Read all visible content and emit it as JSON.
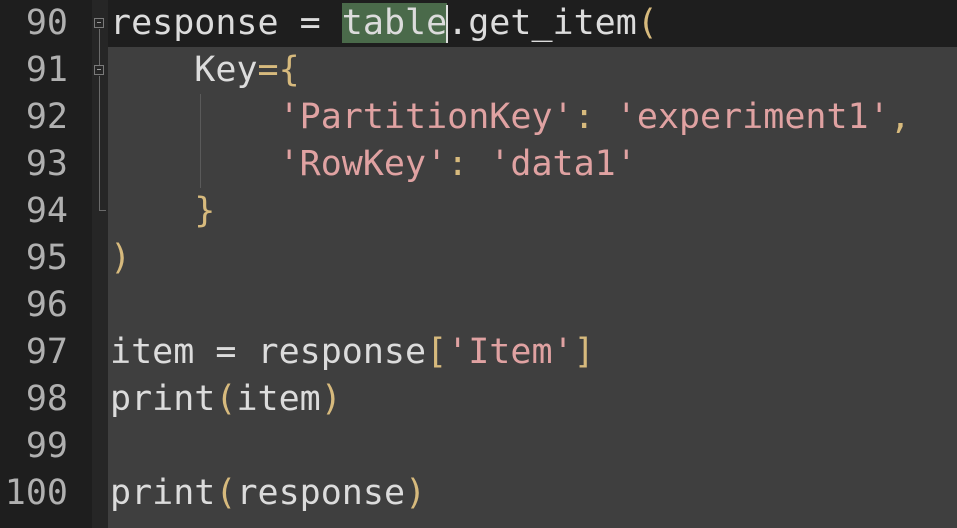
{
  "colors": {
    "background": "#1e1e1e",
    "code_background": "#3f3f3f",
    "line_number": "#b0b0b0",
    "text": "#dcdcdc",
    "punctuation": "#d7ba7d",
    "string": "#e0a2a2",
    "highlight": "#4a6a4a"
  },
  "line_numbers": [
    "90",
    "91",
    "92",
    "93",
    "94",
    "95",
    "96",
    "97",
    "98",
    "99",
    "100"
  ],
  "lines": {
    "l90": {
      "a": "response = ",
      "b": "table",
      "c": ".get_item",
      "d": "("
    },
    "l91": {
      "indent": "    ",
      "a": "Key",
      "b": "={"
    },
    "l92": {
      "indent": "        ",
      "a": "'PartitionKey'",
      "b": ": ",
      "c": "'experiment1'",
      "d": ","
    },
    "l93": {
      "indent": "        ",
      "a": "'RowKey'",
      "b": ": ",
      "c": "'data1'"
    },
    "l94": {
      "indent": "    ",
      "a": "}"
    },
    "l95": {
      "a": ")"
    },
    "l97": {
      "a": "item = response",
      "b": "[",
      "c": "'Item'",
      "d": "]"
    },
    "l98": {
      "a": "print",
      "b": "(",
      "c": "item",
      "d": ")"
    },
    "l100": {
      "a": "print",
      "b": "(",
      "c": "response",
      "d": ")"
    }
  },
  "icons": {
    "fold_marker_1": "fold-collapse-icon",
    "fold_marker_2": "fold-collapse-icon"
  }
}
